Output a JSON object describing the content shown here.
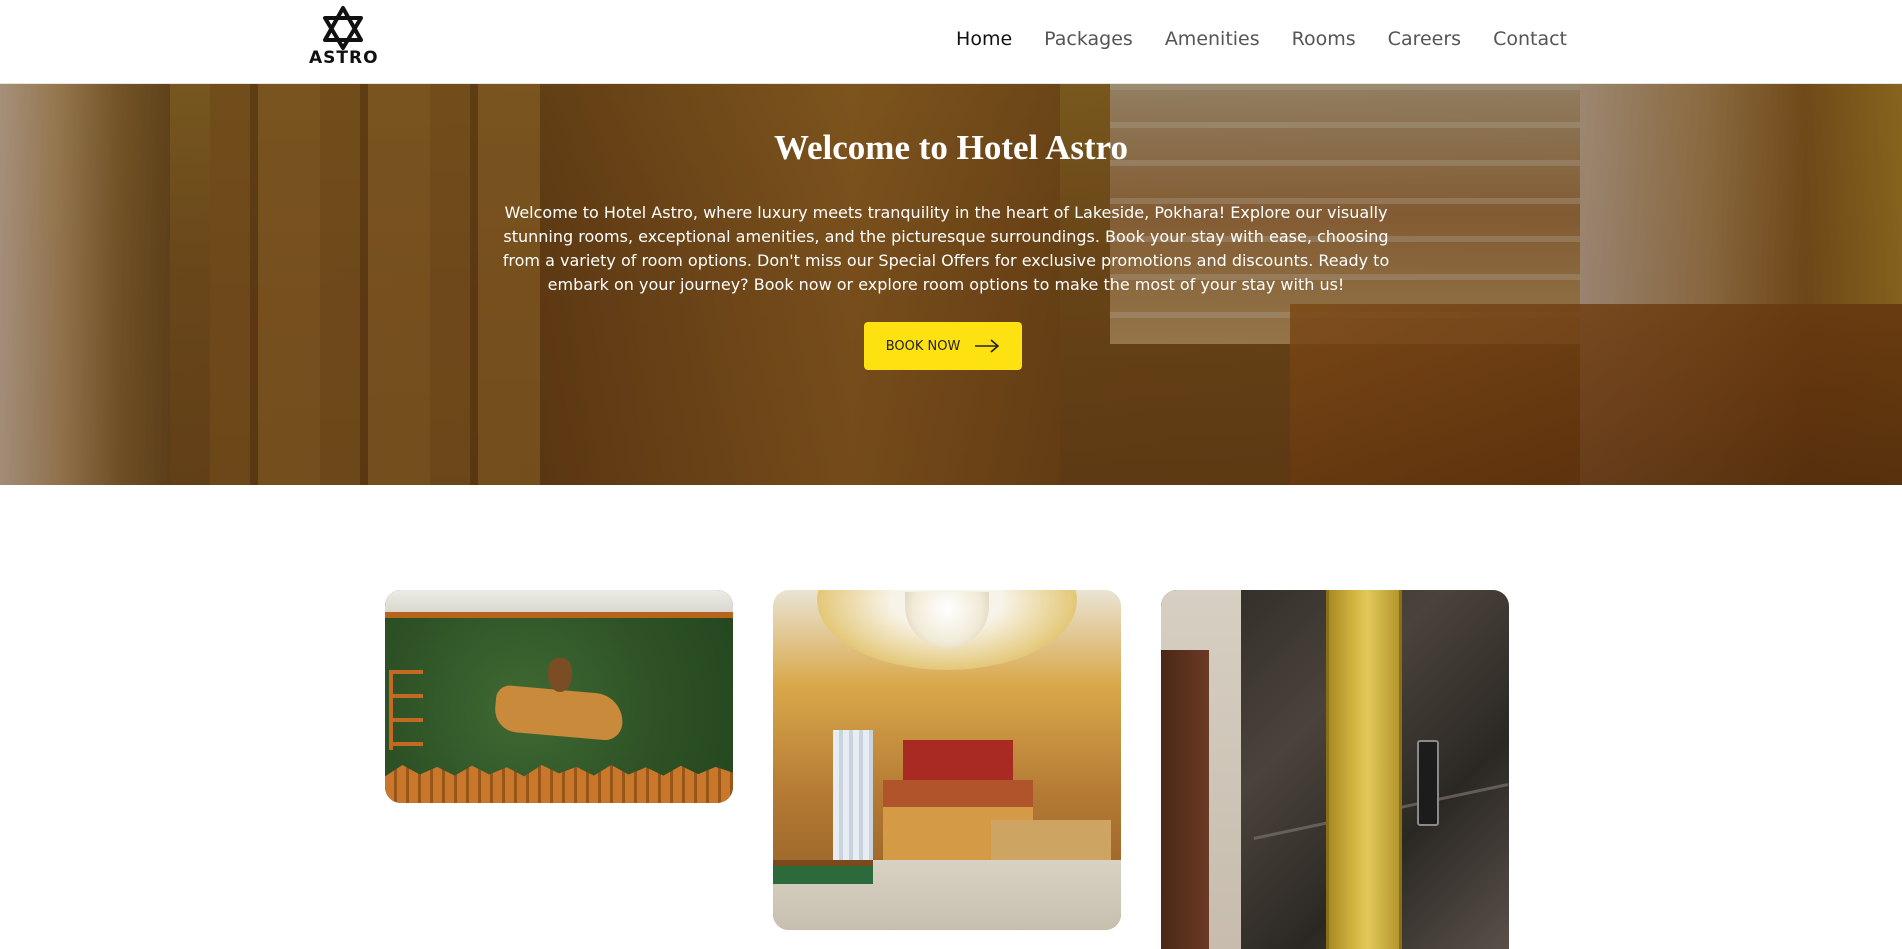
{
  "header": {
    "logo_text": "ASTRO",
    "nav": [
      {
        "label": "Home",
        "active": true
      },
      {
        "label": "Packages",
        "active": false
      },
      {
        "label": "Amenities",
        "active": false
      },
      {
        "label": "Rooms",
        "active": false
      },
      {
        "label": "Careers",
        "active": false
      },
      {
        "label": "Contact",
        "active": false
      }
    ]
  },
  "hero": {
    "title": "Welcome to Hotel Astro",
    "text": "Welcome to Hotel Astro, where luxury meets tranquility in the heart of Lakeside, Pokhara! Explore our visually stunning rooms, exceptional amenities, and the picturesque surroundings. Book your stay with ease, choosing from a variety of room options. Don't miss our Special Offers for exclusive promotions and discounts. Ready to embark on your journey? Book now or explore room options to make the most of your stay with us!",
    "cta_label": "BOOK NOW",
    "cta_icon": "arrow-right-icon"
  },
  "colors": {
    "accent": "#fde110",
    "nav_active": "#111111",
    "nav_inactive": "#555555"
  },
  "gallery": {
    "cards": [
      {
        "name": "reception-wall-photo"
      },
      {
        "name": "lobby-photo"
      },
      {
        "name": "elevator-photo"
      }
    ]
  }
}
